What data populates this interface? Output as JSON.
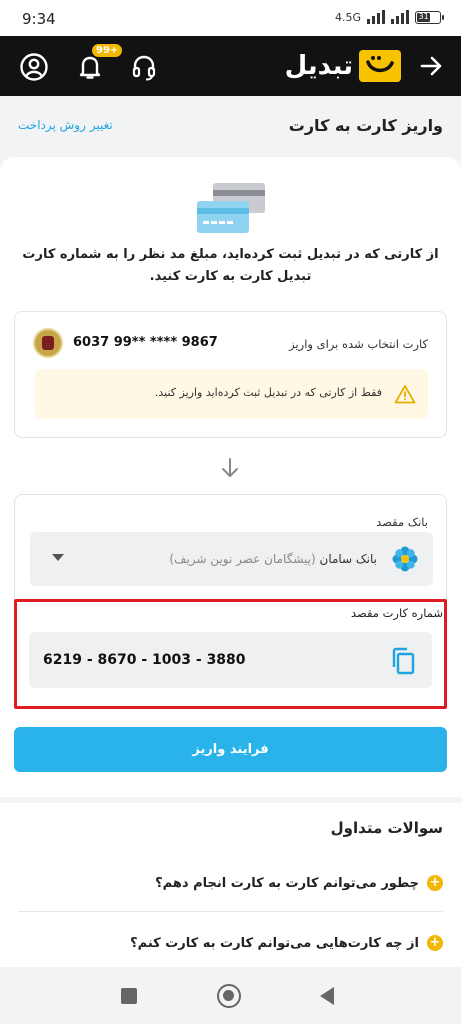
{
  "status_bar": {
    "time": "9:34",
    "network": "4.5G",
    "battery": "31"
  },
  "app_bar": {
    "brand_name": "تبدیل",
    "notification_badge": "99+",
    "icons": [
      "profile-icon",
      "bell-icon",
      "headset-icon",
      "brand-logo-icon",
      "back-arrow-icon"
    ]
  },
  "header": {
    "title": "واریز کارت به کارت",
    "change_method": "تغییر روش پرداخت"
  },
  "intro_text": "از کارتی که در تبدیل ثبت کرده‌اید، مبلغ مد نظر را به شماره کارت تبدیل کارت به کارت کنید.",
  "source": {
    "label": "کارت انتخاب شده برای واریز",
    "card_number": "6037 99** **** 9867",
    "warning": "فقط از کارتی که در تبدیل ثبت کرده‌اید واریز کنید."
  },
  "destination": {
    "bank_label": "بانک مقصد",
    "bank_name": "بانک سامان",
    "bank_sub": "(پیشگامان عصر نوین شریف)",
    "card_label": "شماره کارت مقصد",
    "card_number": "6219 - 8670 - 1003 - 3880"
  },
  "submit_label": "فرایند واریز",
  "faq": {
    "title": "سوالات متداول",
    "questions": [
      "چطور می‌توانم کارت به کارت انجام دهم؟",
      "از چه کارت‌هایی می‌توانم کارت به کارت کنم؟"
    ]
  },
  "colors": {
    "accent": "#2ab3ea",
    "brand_yellow": "#f7c300",
    "highlight_red": "#e01b24"
  }
}
